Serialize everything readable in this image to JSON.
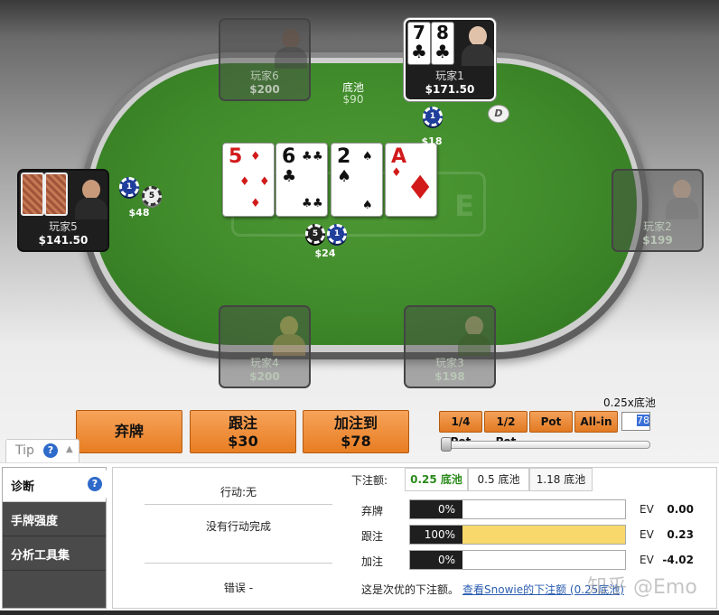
{
  "table": {
    "pot_label": "底池",
    "pot_amount": "$90",
    "dealer_button": "D",
    "logo_text": "E",
    "board": [
      {
        "rank": "5",
        "suit": "♦",
        "color": "red"
      },
      {
        "rank": "6",
        "suit": "♣",
        "color": "black"
      },
      {
        "rank": "2",
        "suit": "♠",
        "color": "black"
      },
      {
        "rank": "A",
        "suit": "♦",
        "color": "red"
      }
    ],
    "players": {
      "p1": {
        "name": "玩家1",
        "stack": "$171.50",
        "cards": [
          {
            "rank": "7",
            "suit": "♣"
          },
          {
            "rank": "8",
            "suit": "♣"
          }
        ]
      },
      "p2": {
        "name": "玩家2",
        "stack": "$199"
      },
      "p3": {
        "name": "玩家3",
        "stack": "$198"
      },
      "p4": {
        "name": "玩家4",
        "stack": "$200"
      },
      "p5": {
        "name": "玩家5",
        "stack": "$141.50"
      },
      "p6": {
        "name": "玩家6",
        "stack": "$200"
      }
    },
    "bets": {
      "p1": {
        "amount": "$18",
        "chips": [
          "1"
        ]
      },
      "p5": {
        "amount": "$48",
        "chips": [
          "1",
          "5"
        ]
      },
      "center": {
        "amount": "$24",
        "chips": [
          "5",
          "1"
        ]
      }
    }
  },
  "actions": {
    "fold": "弃牌",
    "call_label": "跟注",
    "call_amount": "$30",
    "raise_label": "加注到",
    "raise_amount": "$78",
    "pot_buttons": [
      "1/4 Pot",
      "1/2 Pot",
      "Pot",
      "All-in"
    ],
    "ratio_label": "0.25x底池",
    "ratio_value": "78"
  },
  "tip": {
    "label": "Tip",
    "help": "?"
  },
  "panel": {
    "sidebar": [
      {
        "label": "诊断"
      },
      {
        "label": "手牌强度"
      },
      {
        "label": "分析工具集"
      }
    ],
    "action_info": "行动:无",
    "no_action": "没有行动完成",
    "error": "错误 -",
    "bet_size_label": "下注额:",
    "bet_sizes": [
      "0.25 底池",
      "0.5 底池",
      "1.18 底池"
    ],
    "rows": [
      {
        "label": "弃牌",
        "pct": "0%",
        "pct_value": 0,
        "ev_label": "EV",
        "ev": "0.00"
      },
      {
        "label": "跟注",
        "pct": "100%",
        "pct_value": 100,
        "ev_label": "EV",
        "ev": "0.23"
      },
      {
        "label": "加注",
        "pct": "0%",
        "pct_value": 0,
        "ev_label": "EV",
        "ev": "-4.02"
      }
    ],
    "note": "这是次优的下注额。",
    "note_link": "查看Snowie的下注额 (0.25底池)",
    "watermark": "知乎 @Emo"
  }
}
